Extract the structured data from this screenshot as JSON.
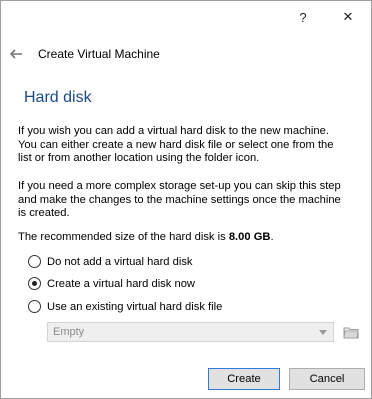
{
  "titlebar": {
    "help_label": "?",
    "close_label": "✕"
  },
  "header": {
    "title": "Create Virtual Machine",
    "back_icon": "back-arrow-icon"
  },
  "page": {
    "heading": "Hard disk",
    "paragraph1": "If you wish you can add a virtual hard disk to the new machine. You can either create a new hard disk file or select one from the list or from another location using the folder icon.",
    "paragraph2": "If you need a more complex storage set-up you can skip this step and make the changes to the machine settings once the machine is created.",
    "recommend_prefix": "The recommended size of the hard disk is ",
    "recommend_size": "8.00 GB",
    "recommend_suffix": "."
  },
  "options": [
    {
      "label": "Do not add a virtual hard disk",
      "checked": false
    },
    {
      "label": "Create a virtual hard disk now",
      "checked": true
    },
    {
      "label": "Use an existing virtual hard disk file",
      "checked": false
    }
  ],
  "existing_disk": {
    "selected": "Empty",
    "folder_icon": "folder-icon"
  },
  "buttons": {
    "create": "Create",
    "cancel": "Cancel"
  }
}
